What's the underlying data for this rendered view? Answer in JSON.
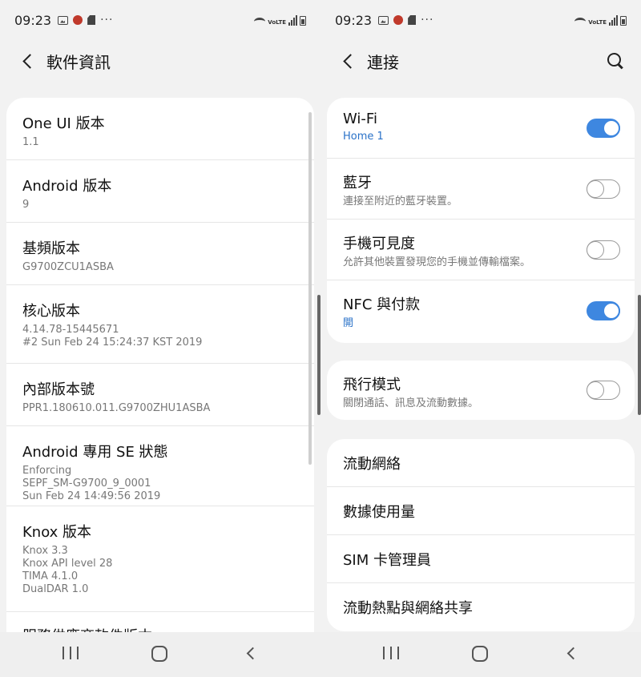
{
  "left": {
    "status_time": "09:23",
    "status_more": "···",
    "status_volte": "VoLTE",
    "header_title": "軟件資訊",
    "items": [
      {
        "title": "One UI 版本",
        "lines": [
          "1.1"
        ]
      },
      {
        "title": "Android 版本",
        "lines": [
          "9"
        ]
      },
      {
        "title": "基頻版本",
        "lines": [
          "G9700ZCU1ASBA"
        ]
      },
      {
        "title": "核心版本",
        "lines": [
          "4.14.78-15445671",
          "#2 Sun Feb 24 15:24:37 KST 2019"
        ]
      },
      {
        "title": "內部版本號",
        "lines": [
          "PPR1.180610.011.G9700ZHU1ASBA"
        ]
      },
      {
        "title": "Android 專用 SE 狀態",
        "lines": [
          "Enforcing",
          "SEPF_SM-G9700_9_0001",
          "Sun Feb 24 14:49:56 2019"
        ]
      },
      {
        "title": "Knox 版本",
        "lines": [
          "Knox 3.3",
          "Knox API level 28",
          "TIMA 4.1.0",
          "DualDAR 1.0"
        ]
      },
      {
        "title": "服務供應商軟件版本"
      }
    ]
  },
  "right": {
    "status_time": "09:23",
    "status_more": "···",
    "status_volte": "VoLTE",
    "header_title": "連接",
    "group1": [
      {
        "title": "Wi-Fi",
        "subtitle": "Home 1",
        "toggle": "on"
      },
      {
        "title": "藍牙",
        "subtitle": "連接至附近的藍牙裝置。",
        "toggle": "off"
      },
      {
        "title": "手機可見度",
        "subtitle": "允許其他裝置發現您的手機並傳輸檔案。",
        "toggle": "off"
      },
      {
        "title": "NFC 與付款",
        "subtitle": "開",
        "toggle": "on"
      }
    ],
    "group2": [
      {
        "title": "飛行模式",
        "subtitle": "關閉通話、訊息及流動數據。",
        "toggle": "off"
      }
    ],
    "group3": [
      {
        "title": "流動網絡"
      },
      {
        "title": "數據使用量"
      },
      {
        "title": "SIM 卡管理員"
      },
      {
        "title": "流動熱點與網絡共享"
      }
    ]
  },
  "colors": {
    "accent": "#3e87e0",
    "link": "#2a72c8"
  }
}
